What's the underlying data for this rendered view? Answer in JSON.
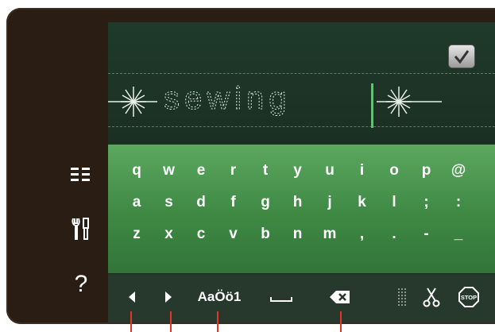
{
  "sidebar": {
    "items": [
      {
        "icon": "stitch-menu-icon"
      },
      {
        "icon": "tools-icon"
      },
      {
        "icon": "help-icon",
        "label": "?"
      }
    ]
  },
  "editor": {
    "text": "sewing",
    "ok_icon": "checkmark-icon"
  },
  "keyboard": {
    "rows": [
      [
        "q",
        "w",
        "e",
        "r",
        "t",
        "y",
        "u",
        "i",
        "o",
        "p",
        "@"
      ],
      [
        "a",
        "s",
        "d",
        "f",
        "g",
        "h",
        "j",
        "k",
        "l",
        ";",
        ":"
      ],
      [
        "z",
        "x",
        "c",
        "v",
        "b",
        "n",
        "m",
        ",",
        ".",
        "-",
        "_"
      ]
    ]
  },
  "toolbar": {
    "left_icon": "arrow-left-icon",
    "right_icon": "arrow-right-icon",
    "case_label_a": "Aa",
    "case_label_b": "Öö1",
    "space_icon": "space-icon",
    "backspace_icon": "backspace-icon",
    "stitch_icon": "tie-off-icon",
    "cut_icon": "scissors-icon",
    "stop_label": "STOP"
  },
  "colors": {
    "frame": "#2a1e14",
    "keyboard_green": "#3f8a45",
    "accent_green": "#48d35a",
    "pointer_red": "#e53527"
  }
}
